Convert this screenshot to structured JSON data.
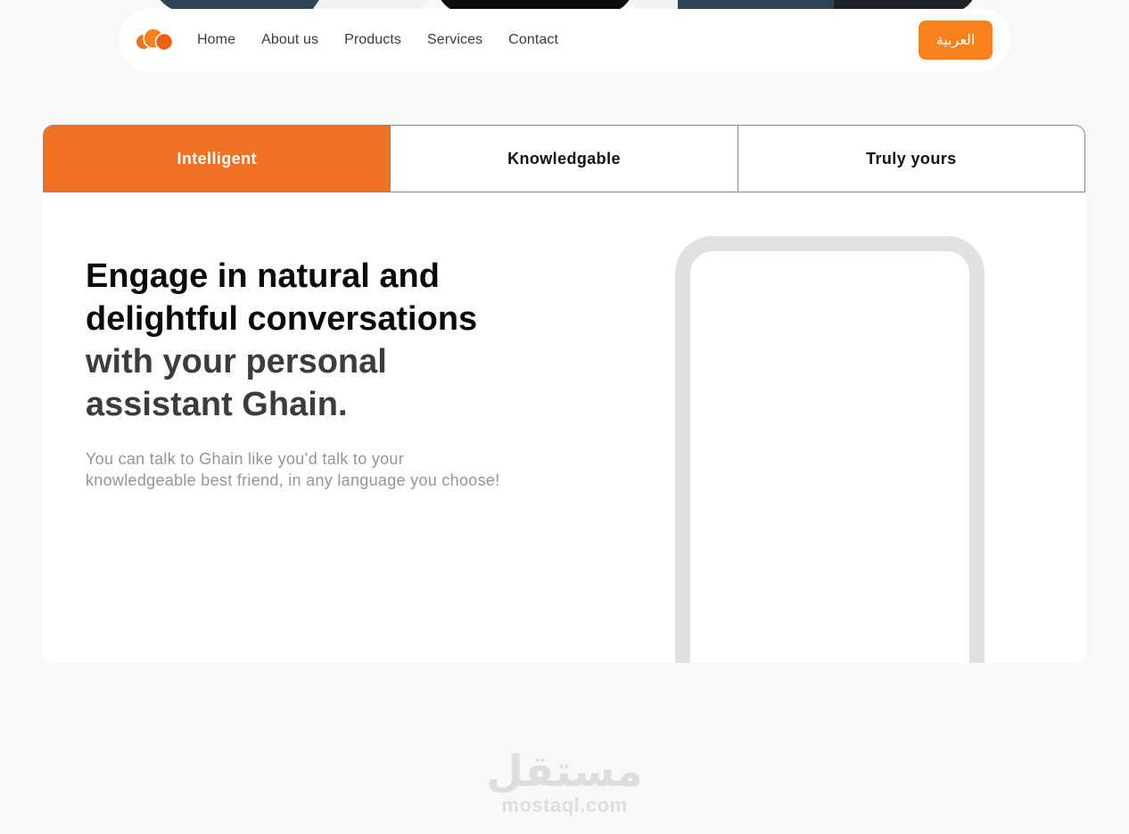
{
  "nav": {
    "logo_icon": "brand-circles-logo",
    "links": [
      "Home",
      "About us",
      "Products",
      "Services",
      "Contact"
    ],
    "language_button": "العربية"
  },
  "tabs": [
    {
      "label": "Intelligent",
      "active": true
    },
    {
      "label": "Knowledgable",
      "active": false
    },
    {
      "label": "Truly yours",
      "active": false
    }
  ],
  "content": {
    "headline_strong": "Engage in natural and delightful conversations",
    "headline_soft": "with your personal assistant Ghain.",
    "subtext": "You can talk to Ghain like you’d talk to your knowledgeable best friend, in any language you choose!"
  },
  "watermark": {
    "arabic": "مستقل",
    "latin": "mostaql.com"
  },
  "colors": {
    "accent": "#ef7224",
    "button": "#f7821b",
    "background": "#f9f8f6",
    "phone_frame": "#e1e1e1"
  }
}
